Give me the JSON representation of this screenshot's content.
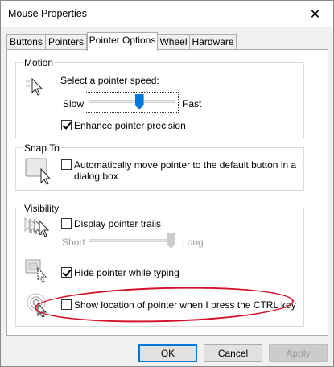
{
  "window": {
    "title": "Mouse Properties",
    "close_glyph": "✕"
  },
  "tabs": [
    {
      "label": "Buttons"
    },
    {
      "label": "Pointers"
    },
    {
      "label": "Pointer Options"
    },
    {
      "label": "Wheel"
    },
    {
      "label": "Hardware"
    }
  ],
  "motion": {
    "group_label": "Motion",
    "speed_label": "Select a pointer speed:",
    "slow_label": "Slow",
    "fast_label": "Fast",
    "speed_level": 0.6,
    "enhance_label": "Enhance pointer precision",
    "enhance_checked": true
  },
  "snap_to": {
    "group_label": "Snap To",
    "auto_move_label_line1": "Automatically move pointer to the default button in a",
    "auto_move_label_line2": "dialog box",
    "auto_move_checked": false
  },
  "visibility": {
    "group_label": "Visibility",
    "trails_label": "Display pointer trails",
    "trails_checked": false,
    "short_label": "Short",
    "long_label": "Long",
    "trails_level": 1.0,
    "hide_label": "Hide pointer while typing",
    "hide_checked": true,
    "show_location_label": "Show location of pointer when I press the CTRL key",
    "show_location_checked": false
  },
  "buttons": {
    "ok": "OK",
    "cancel": "Cancel",
    "apply": "Apply"
  },
  "colors": {
    "accent": "#0078d7",
    "annotation": "#d3152b"
  }
}
